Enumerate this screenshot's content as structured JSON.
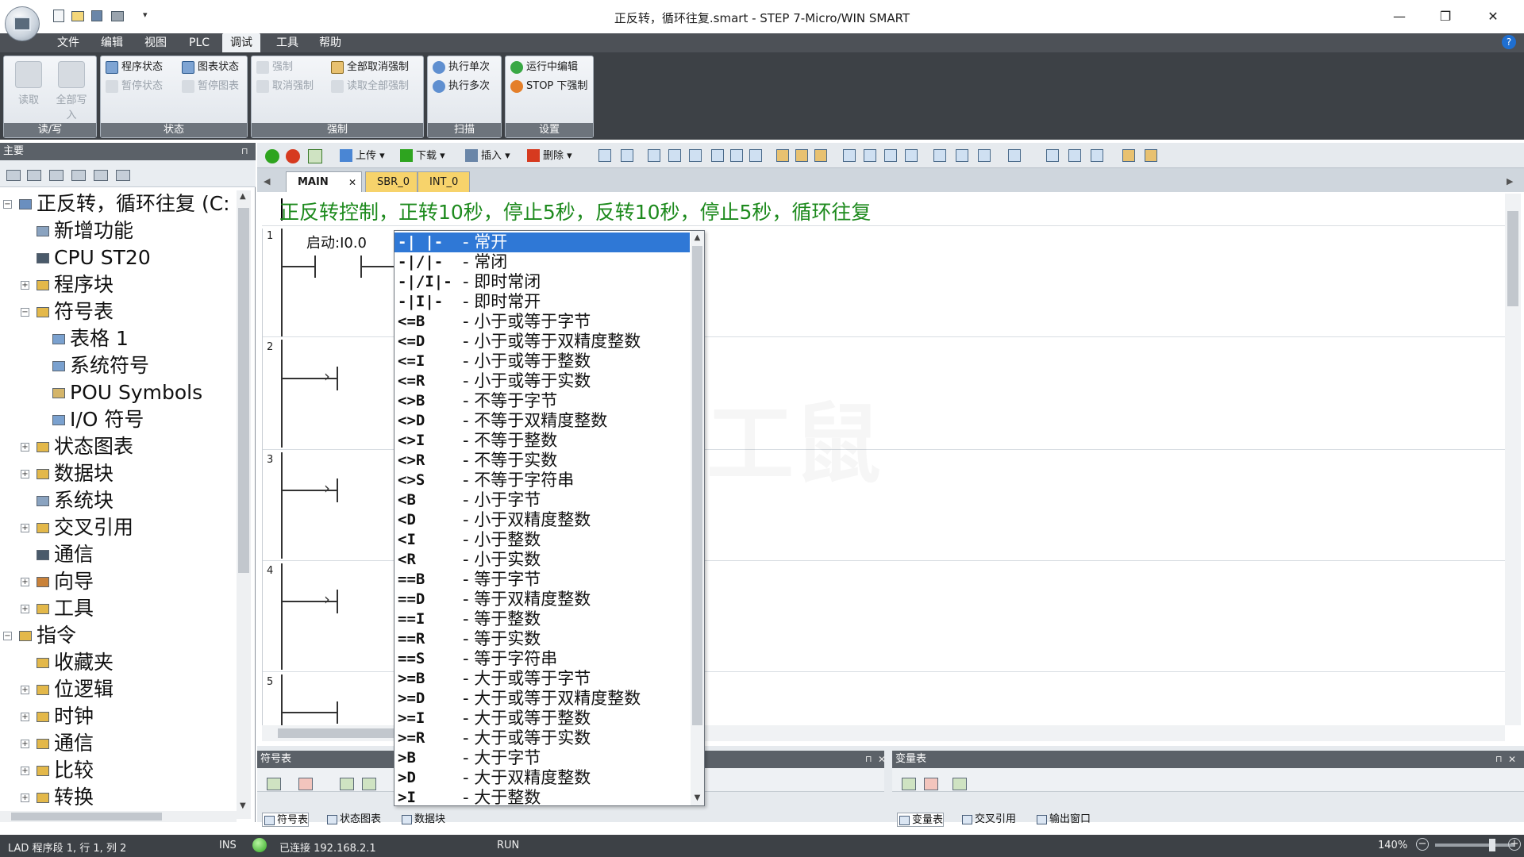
{
  "window": {
    "title": "正反转，循环往复.smart - STEP 7-Micro/WIN SMART",
    "minimize": "—",
    "restore": "❐",
    "close": "✕"
  },
  "menu": [
    "文件",
    "编辑",
    "视图",
    "PLC",
    "调试",
    "工具",
    "帮助"
  ],
  "menu_active_index": 4,
  "ribbon": {
    "rw": {
      "title": "读/写",
      "read": "读取",
      "write_all": "全部写入"
    },
    "status": {
      "title": "状态",
      "program_status": "程序状态",
      "pause_status": "暂停状态",
      "chart_status": "图表状态",
      "pause_chart": "暂停图表"
    },
    "force": {
      "title": "强制",
      "force": "强制",
      "unforce": "取消强制",
      "unforce_all": "全部取消强制",
      "read_all_forced": "读取全部强制"
    },
    "scan": {
      "title": "扫描",
      "single": "执行单次",
      "multiple": "执行多次"
    },
    "settings": {
      "title": "设置",
      "run_edit": "运行中编辑",
      "stop_force": "STOP 下强制"
    }
  },
  "left_panel": {
    "header": "主要",
    "pin": "⊓",
    "tree": [
      {
        "label": "正反转，循环往复 (C:",
        "level": 0,
        "expander": "−"
      },
      {
        "label": "新增功能",
        "level": 1,
        "expander": ""
      },
      {
        "label": "CPU ST20",
        "level": 1,
        "expander": ""
      },
      {
        "label": "程序块",
        "level": 1,
        "expander": "+"
      },
      {
        "label": "符号表",
        "level": 1,
        "expander": "−"
      },
      {
        "label": "表格 1",
        "level": 2,
        "expander": ""
      },
      {
        "label": "系统符号",
        "level": 2,
        "expander": ""
      },
      {
        "label": "POU Symbols",
        "level": 2,
        "expander": ""
      },
      {
        "label": "I/O 符号",
        "level": 2,
        "expander": ""
      },
      {
        "label": "状态图表",
        "level": 1,
        "expander": "+"
      },
      {
        "label": "数据块",
        "level": 1,
        "expander": "+"
      },
      {
        "label": "系统块",
        "level": 1,
        "expander": ""
      },
      {
        "label": "交叉引用",
        "level": 1,
        "expander": "+"
      },
      {
        "label": "通信",
        "level": 1,
        "expander": ""
      },
      {
        "label": "向导",
        "level": 1,
        "expander": "+"
      },
      {
        "label": "工具",
        "level": 1,
        "expander": "+"
      },
      {
        "label": "指令",
        "level": 0,
        "expander": "−"
      },
      {
        "label": "收藏夹",
        "level": 1,
        "expander": ""
      },
      {
        "label": "位逻辑",
        "level": 1,
        "expander": "+"
      },
      {
        "label": "时钟",
        "level": 1,
        "expander": "+"
      },
      {
        "label": "通信",
        "level": 1,
        "expander": "+"
      },
      {
        "label": "比较",
        "level": 1,
        "expander": "+"
      },
      {
        "label": "转换",
        "level": 1,
        "expander": "+"
      }
    ]
  },
  "editor_toolbar": {
    "upload": "上传",
    "download": "下载",
    "insert": "插入",
    "delete": "删除"
  },
  "tabs": {
    "main": "MAIN",
    "main_close": "✕",
    "sbr": "SBR_0",
    "int": "INT_0"
  },
  "program_comment": "正反转控制，正转10秒，停止5秒，反转10秒，停止5秒，循环往复",
  "rungs": [
    "1",
    "2",
    "3",
    "4",
    "5"
  ],
  "contact_label": "启动:I0.0",
  "instruction_list": [
    {
      "symbol": "-| |-",
      "desc": "- 常开"
    },
    {
      "symbol": "-|/|-",
      "desc": "- 常闭"
    },
    {
      "symbol": "-|/I|-",
      "desc": "- 即时常闭"
    },
    {
      "symbol": "-|I|-",
      "desc": "- 即时常开"
    },
    {
      "symbol": "<=B",
      "desc": "- 小于或等于字节"
    },
    {
      "symbol": "<=D",
      "desc": "- 小于或等于双精度整数"
    },
    {
      "symbol": "<=I",
      "desc": "- 小于或等于整数"
    },
    {
      "symbol": "<=R",
      "desc": "- 小于或等于实数"
    },
    {
      "symbol": "<>B",
      "desc": "- 不等于字节"
    },
    {
      "symbol": "<>D",
      "desc": "- 不等于双精度整数"
    },
    {
      "symbol": "<>I",
      "desc": "- 不等于整数"
    },
    {
      "symbol": "<>R",
      "desc": "- 不等于实数"
    },
    {
      "symbol": "<>S",
      "desc": "- 不等于字符串"
    },
    {
      "symbol": "<B",
      "desc": "- 小于字节"
    },
    {
      "symbol": "<D",
      "desc": "- 小于双精度整数"
    },
    {
      "symbol": "<I",
      "desc": "- 小于整数"
    },
    {
      "symbol": "<R",
      "desc": "- 小于实数"
    },
    {
      "symbol": "==B",
      "desc": "- 等于字节"
    },
    {
      "symbol": "==D",
      "desc": "- 等于双精度整数"
    },
    {
      "symbol": "==I",
      "desc": "- 等于整数"
    },
    {
      "symbol": "==R",
      "desc": "- 等于实数"
    },
    {
      "symbol": "==S",
      "desc": "- 等于字符串"
    },
    {
      "symbol": ">=B",
      "desc": "- 大于或等于字节"
    },
    {
      "symbol": ">=D",
      "desc": "- 大于或等于双精度整数"
    },
    {
      "symbol": ">=I",
      "desc": "- 大于或等于整数"
    },
    {
      "symbol": ">=R",
      "desc": "- 大于或等于实数"
    },
    {
      "symbol": ">B",
      "desc": "- 大于字节"
    },
    {
      "symbol": ">D",
      "desc": "- 大于双精度整数"
    },
    {
      "symbol": ">I",
      "desc": "- 大于整数"
    }
  ],
  "instruction_selected_index": 0,
  "watermark": "电工鼠",
  "bottom": {
    "symbol_panel_title": "符号表",
    "var_panel_title": "变量表",
    "left_tabs": [
      "符号表",
      "状态图表",
      "数据块"
    ],
    "right_tabs": [
      "变量表",
      "交叉引用",
      "输出窗口"
    ]
  },
  "status": {
    "position": "LAD 程序段 1, 行 1, 列 2",
    "ins": "INS",
    "connection": "已连接 192.168.2.1",
    "mode": "RUN",
    "zoom": "140%",
    "zoom_out": "−",
    "zoom_in": "+"
  }
}
